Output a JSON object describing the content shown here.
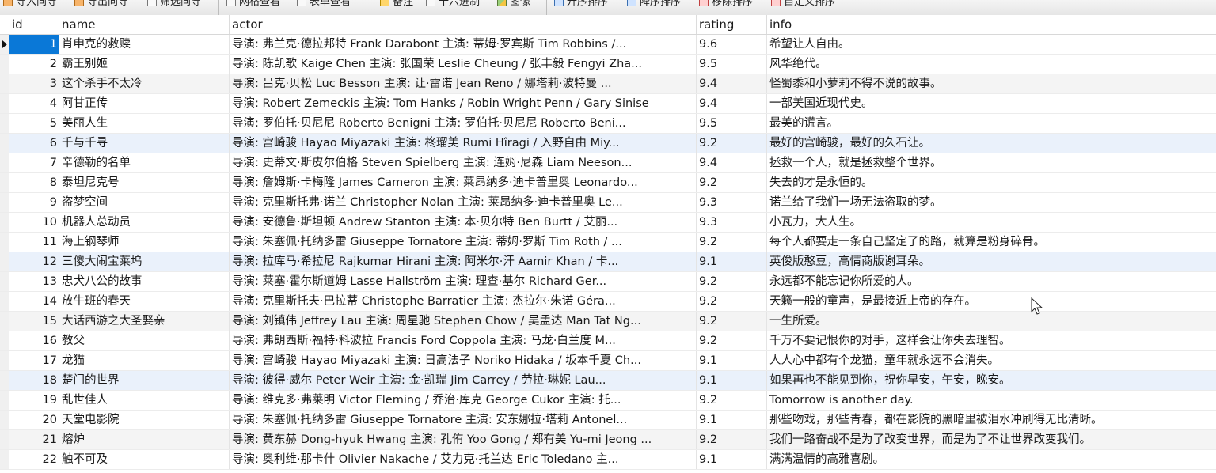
{
  "toolbar": {
    "items": [
      {
        "label": "导入向导",
        "icon": "import-icon"
      },
      {
        "label": "导出向导",
        "icon": "export-icon"
      },
      {
        "label": "筛选向导",
        "icon": "filter-icon"
      },
      {
        "label": "网格查看",
        "icon": "grid-view-icon"
      },
      {
        "label": "表单查看",
        "icon": "form-view-icon"
      },
      {
        "label": "备注",
        "icon": "note-icon"
      },
      {
        "label": "十六进制",
        "icon": "hex-icon"
      },
      {
        "label": "图像",
        "icon": "image-icon"
      },
      {
        "label": "升序排序",
        "icon": "sort-asc-icon"
      },
      {
        "label": "降序排序",
        "icon": "sort-desc-icon"
      },
      {
        "label": "移除排序",
        "icon": "remove-sort-icon"
      },
      {
        "label": "自定义排序",
        "icon": "custom-sort-icon"
      }
    ]
  },
  "table": {
    "columns": [
      "id",
      "name",
      "actor",
      "rating",
      "info"
    ],
    "selected_row": 1,
    "rows": [
      {
        "id": "1",
        "name": "肖申克的救赎",
        "actor": "导演: 弗兰克·德拉邦特 Frank Darabont   主演: 蒂姆·罗宾斯 Tim Robbins /...",
        "rating": "9.6",
        "info": "希望让人自由。"
      },
      {
        "id": "2",
        "name": "霸王别姬",
        "actor": "导演: 陈凯歌 Kaige Chen   主演: 张国荣 Leslie Cheung / 张丰毅 Fengyi Zha...",
        "rating": "9.5",
        "info": "风华绝代。"
      },
      {
        "id": "3",
        "name": "这个杀手不太冷",
        "actor": "导演: 吕克·贝松 Luc Besson   主演: 让·雷诺 Jean Reno / 娜塔莉·波特曼 ...",
        "rating": "9.4",
        "info": "怪蜀黍和小萝莉不得不说的故事。"
      },
      {
        "id": "4",
        "name": "阿甘正传",
        "actor": "导演: Robert Zemeckis   主演: Tom Hanks / Robin Wright Penn / Gary Sinise",
        "rating": "9.4",
        "info": "一部美国近现代史。"
      },
      {
        "id": "5",
        "name": "美丽人生",
        "actor": "导演: 罗伯托·贝尼尼 Roberto Benigni   主演: 罗伯托·贝尼尼 Roberto Beni...",
        "rating": "9.5",
        "info": "最美的谎言。"
      },
      {
        "id": "6",
        "name": "千与千寻",
        "actor": "导演: 宫崎骏 Hayao Miyazaki   主演: 柊瑠美 Rumi Hîragi / 入野自由 Miy...",
        "rating": "9.2",
        "info": "最好的宫崎骏，最好的久石让。"
      },
      {
        "id": "7",
        "name": "辛德勒的名单",
        "actor": "导演: 史蒂文·斯皮尔伯格 Steven Spielberg   主演: 连姆·尼森 Liam Neeson...",
        "rating": "9.4",
        "info": "拯救一个人，就是拯救整个世界。"
      },
      {
        "id": "8",
        "name": "泰坦尼克号",
        "actor": "导演: 詹姆斯·卡梅隆 James Cameron   主演: 莱昂纳多·迪卡普里奥 Leonardo...",
        "rating": "9.2",
        "info": "失去的才是永恒的。"
      },
      {
        "id": "9",
        "name": "盗梦空间",
        "actor": "导演: 克里斯托弗·诺兰 Christopher Nolan   主演: 莱昂纳多·迪卡普里奥 Le...",
        "rating": "9.3",
        "info": "诺兰给了我们一场无法盗取的梦。"
      },
      {
        "id": "10",
        "name": "机器人总动员",
        "actor": "导演: 安德鲁·斯坦顿 Andrew Stanton   主演: 本·贝尔特 Ben Burtt / 艾丽...",
        "rating": "9.3",
        "info": "小瓦力，大人生。"
      },
      {
        "id": "11",
        "name": "海上钢琴师",
        "actor": "导演: 朱塞佩·托纳多雷 Giuseppe Tornatore   主演: 蒂姆·罗斯 Tim Roth / ...",
        "rating": "9.2",
        "info": "每个人都要走一条自己坚定了的路，就算是粉身碎骨。"
      },
      {
        "id": "12",
        "name": "三傻大闹宝莱坞",
        "actor": "导演: 拉库马·希拉尼 Rajkumar Hirani   主演: 阿米尔·汗 Aamir Khan / 卡...",
        "rating": "9.1",
        "info": "英俊版憨豆，高情商版谢耳朵。"
      },
      {
        "id": "13",
        "name": "忠犬八公的故事",
        "actor": "导演: 莱塞·霍尔斯道姆 Lasse Hallström   主演: 理查·基尔 Richard Ger...",
        "rating": "9.2",
        "info": "永远都不能忘记你所爱的人。"
      },
      {
        "id": "14",
        "name": "放牛班的春天",
        "actor": "导演: 克里斯托夫·巴拉蒂 Christophe Barratier   主演: 杰拉尔·朱诺 Géra...",
        "rating": "9.2",
        "info": "天籁一般的童声，是最接近上帝的存在。"
      },
      {
        "id": "15",
        "name": "大话西游之大圣娶亲",
        "actor": "导演: 刘镇伟 Jeffrey Lau   主演: 周星驰 Stephen Chow / 吴孟达 Man Tat Ng...",
        "rating": "9.2",
        "info": "一生所爱。"
      },
      {
        "id": "16",
        "name": "教父",
        "actor": "导演: 弗朗西斯·福特·科波拉 Francis Ford Coppola   主演: 马龙·白兰度 M...",
        "rating": "9.2",
        "info": "千万不要记恨你的对手，这样会让你失去理智。"
      },
      {
        "id": "17",
        "name": "龙猫",
        "actor": "导演: 宫崎骏 Hayao Miyazaki   主演: 日高法子 Noriko Hidaka / 坂本千夏 Ch...",
        "rating": "9.1",
        "info": "人人心中都有个龙猫，童年就永远不会消失。"
      },
      {
        "id": "18",
        "name": "楚门的世界",
        "actor": "导演: 彼得·威尔 Peter Weir   主演: 金·凯瑞 Jim Carrey / 劳拉·琳妮 Lau...",
        "rating": "9.1",
        "info": "如果再也不能见到你，祝你早安，午安，晚安。"
      },
      {
        "id": "19",
        "name": "乱世佳人",
        "actor": "导演: 维克多·弗莱明 Victor Fleming / 乔治·库克 George Cukor   主演: 托...",
        "rating": "9.2",
        "info": "Tomorrow is another day."
      },
      {
        "id": "20",
        "name": "天堂电影院",
        "actor": "导演: 朱塞佩·托纳多雷 Giuseppe Tornatore   主演: 安东娜拉·塔莉 Antonel...",
        "rating": "9.1",
        "info": "那些吻戏，那些青春，都在影院的黑暗里被泪水冲刷得无比清晰。"
      },
      {
        "id": "21",
        "name": "熔炉",
        "actor": "导演: 黄东赫 Dong-hyuk Hwang   主演: 孔侑 Yoo Gong / 郑有美 Yu-mi Jeong ...",
        "rating": "9.2",
        "info": "我们一路奋战不是为了改变世界，而是为了不让世界改变我们。"
      },
      {
        "id": "22",
        "name": "触不可及",
        "actor": "导演: 奥利维·那卡什 Olivier Nakache / 艾力克·托兰达 Eric Toledano   主...",
        "rating": "9.1",
        "info": "满满温情的高雅喜剧。"
      }
    ]
  },
  "colors": {
    "selection": "#0a78d7",
    "row_alt": "#f4f4f4",
    "row_highlight": "#eaf1fb"
  }
}
